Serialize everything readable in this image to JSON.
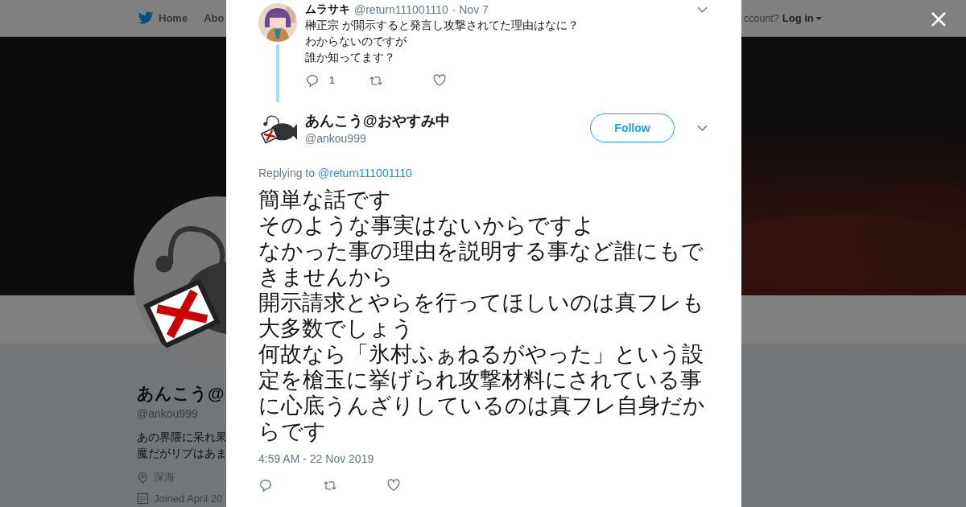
{
  "background_page": {
    "nav": [
      {
        "label": "Home",
        "kind": "home"
      },
      {
        "label": "Abo",
        "kind": "link"
      }
    ],
    "account_prompt": "ccount?",
    "login": "Log in",
    "profile": {
      "name": "あんこう@",
      "handle": "@ankou999",
      "bio": [
        "あの界隈に呆れ果",
        "魔だがリプはあま"
      ],
      "location": "深海",
      "joined": "Joined April 20"
    }
  },
  "modal": {
    "parent_tweet": {
      "name": "ムラサキ",
      "handle": "@return111001110",
      "date": "· Nov 7",
      "lines": [
        "榊正宗 が開示すると発言し攻撃されてた理由はなに？",
        "わからないのですが",
        "誰か知ってます？"
      ],
      "reply_count": "1"
    },
    "tweet": {
      "name": "あんこう@おやすみ中",
      "handle": "@ankou999",
      "follow": "Follow",
      "replying_prefix": "Replying to",
      "replying_to": "@return111001110",
      "lines": [
        "簡単な話です",
        "そのような事実はないからですよ",
        "なかった事の理由を説明する事など誰にもできませんから",
        "開示請求とやらを行ってほしいのは真フレも大多数でしょう",
        "何故なら「氷村ふぁねるがやった」という設定を槍玉に挙げられ攻撃材料にされている事に心底うんざりしているのは真フレ自身だからです"
      ],
      "timestamp": "4:59 AM - 22 Nov 2019"
    }
  }
}
